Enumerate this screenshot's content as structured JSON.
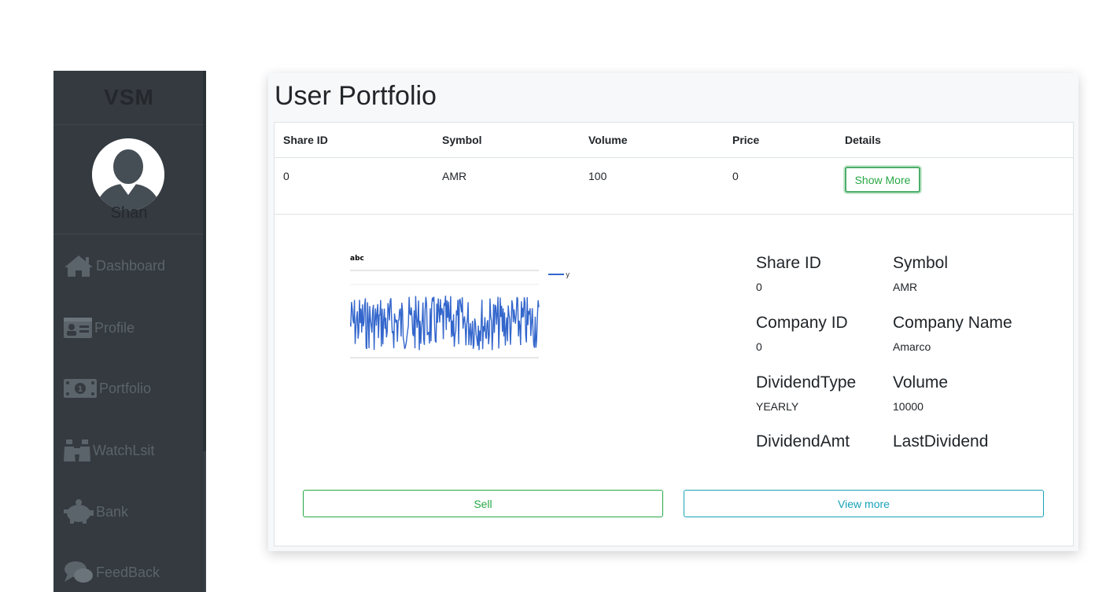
{
  "sidebar": {
    "brand": "VSM",
    "username": "Shan",
    "items": [
      {
        "label": "Dashboard",
        "icon": "home-icon"
      },
      {
        "label": "Profile",
        "icon": "id-card-icon"
      },
      {
        "label": "Portfolio",
        "icon": "money-bill-icon"
      },
      {
        "label": "WatchLsit",
        "icon": "binoculars-icon"
      },
      {
        "label": "Bank",
        "icon": "piggy-bank-icon"
      },
      {
        "label": "FeedBack",
        "icon": "comments-icon"
      }
    ]
  },
  "main": {
    "title": "User Portfolio",
    "table": {
      "headers": [
        "Share ID",
        "Symbol",
        "Volume",
        "Price",
        "Details"
      ],
      "rows": [
        {
          "share_id": "0",
          "symbol": "AMR",
          "volume": "100",
          "price": "0",
          "details_button": "Show More"
        }
      ]
    },
    "details": {
      "chart_title": "abc",
      "legend_label": "y",
      "fields": [
        {
          "label": "Share ID",
          "value": "0"
        },
        {
          "label": "Symbol",
          "value": "AMR"
        },
        {
          "label": "Company ID",
          "value": "0"
        },
        {
          "label": "Company Name",
          "value": "Amarco"
        },
        {
          "label": "DividendType",
          "value": "YEARLY"
        },
        {
          "label": "Volume",
          "value": "10000"
        },
        {
          "label": "DividendAmt",
          "value": ""
        },
        {
          "label": "LastDividend",
          "value": ""
        }
      ],
      "sell_label": "Sell",
      "view_more_label": "View more"
    }
  },
  "colors": {
    "sidebar_bg": "#343a40",
    "success": "#28a745",
    "info": "#17a2b8",
    "chart_line": "#3366cc"
  }
}
